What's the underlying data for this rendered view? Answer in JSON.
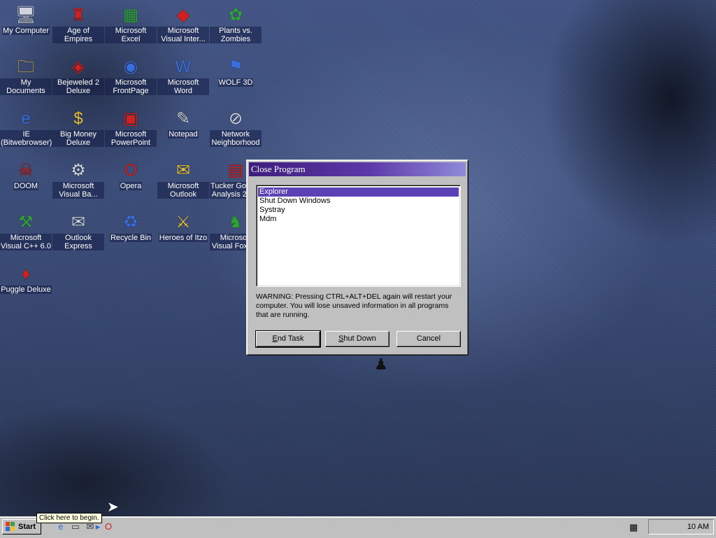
{
  "desktop": {
    "icons": [
      {
        "label": "My Computer",
        "glyph": "🖥",
        "tone": "gray"
      },
      {
        "label": "Age of Empires",
        "glyph": "♜",
        "tone": "red"
      },
      {
        "label": "Microsoft Excel",
        "glyph": "▦",
        "tone": "green"
      },
      {
        "label": "Microsoft Visual Inter...",
        "glyph": "◆",
        "tone": "red"
      },
      {
        "label": "Plants vs. Zombies",
        "glyph": "✿",
        "tone": "green"
      },
      {
        "label": "My Documents",
        "glyph": "🗀",
        "tone": "yellow"
      },
      {
        "label": "Bejeweled 2 Deluxe",
        "glyph": "◈",
        "tone": "red"
      },
      {
        "label": "Microsoft FrontPage",
        "glyph": "◉",
        "tone": "blue"
      },
      {
        "label": "Microsoft Word",
        "glyph": "W",
        "tone": "blue"
      },
      {
        "label": "WOLF 3D",
        "glyph": "⚑",
        "tone": "blue"
      },
      {
        "label": "IE (Bitwebrowser)",
        "glyph": "e",
        "tone": "blue"
      },
      {
        "label": "Big Money Deluxe",
        "glyph": "$",
        "tone": "yellow"
      },
      {
        "label": "Microsoft PowerPoint",
        "glyph": "▣",
        "tone": "red"
      },
      {
        "label": "Notepad",
        "glyph": "✎",
        "tone": "gray"
      },
      {
        "label": "Network Neighborhood",
        "glyph": "⊘",
        "tone": "gray"
      },
      {
        "label": "DOOM",
        "glyph": "☠",
        "tone": "red"
      },
      {
        "label": "Microsoft Visual Ba...",
        "glyph": "⚙",
        "tone": "gray"
      },
      {
        "label": "Opera",
        "glyph": "O",
        "tone": "red"
      },
      {
        "label": "Microsoft Outlook",
        "glyph": "✉",
        "tone": "yellow"
      },
      {
        "label": "Tucker Google Analysis 2010",
        "glyph": "▤",
        "tone": "red"
      },
      {
        "label": "Microsoft Visual C++ 6.0",
        "glyph": "⚒",
        "tone": "green"
      },
      {
        "label": "Outlook Express",
        "glyph": "✉",
        "tone": "gray"
      },
      {
        "label": "Recycle Bin",
        "glyph": "♻",
        "tone": "blue"
      },
      {
        "label": "Heroes of Itzo",
        "glyph": "⚔",
        "tone": "yellow"
      },
      {
        "label": "Microsoft Visual FoxPro",
        "glyph": "♞",
        "tone": "green"
      },
      {
        "label": "Puggle Deluxe",
        "glyph": "♦",
        "tone": "red"
      }
    ]
  },
  "dialog": {
    "title": "Close Program",
    "processes": [
      "Explorer",
      "Shut Down Windows",
      "Systray",
      "Mdm"
    ],
    "selected_index": 0,
    "warning": "WARNING: Pressing CTRL+ALT+DEL again will restart your computer. You will lose unsaved information in all programs that are running.",
    "buttons": {
      "end_task": {
        "access_key": "E",
        "rest": "nd Task"
      },
      "shut_down": {
        "access_key": "S",
        "rest": "hut Down"
      },
      "cancel": "Cancel"
    }
  },
  "taskbar": {
    "start_label": "Start",
    "tooltip": "Click here to begin.",
    "quick_launch": [
      "ie-icon",
      "desktop-icon",
      "outlook-icon",
      "channels-icon",
      "opera-icon"
    ],
    "clock": "10 AM"
  },
  "colors": {
    "title_start": "#3d1e7c",
    "title_end": "#8f8ad8",
    "selection": "#5b41b5",
    "face": "#c0c0c0"
  }
}
